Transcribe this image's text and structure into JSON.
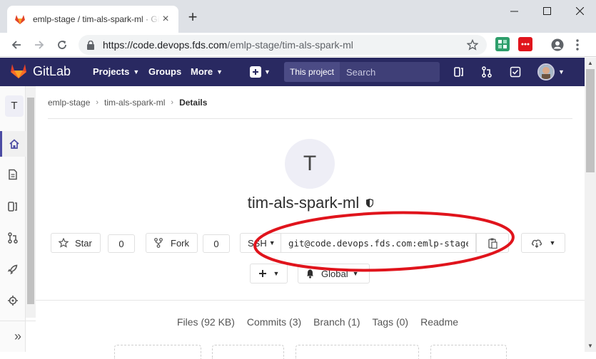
{
  "browser": {
    "tab_title": "emlp-stage / tim-als-spark-ml · GitLab",
    "tab_close": "×",
    "new_tab": "+",
    "url_host": "https://code.devops.fds.com",
    "url_path": "/emlp-stage/tim-als-spark-ml"
  },
  "gitlab_nav": {
    "brand": "GitLab",
    "projects": "Projects",
    "groups": "Groups",
    "more": "More",
    "scope": "This project",
    "search_placeholder": "Search"
  },
  "sidebar": {
    "project_initial": "T",
    "collapse_glyph": "»"
  },
  "breadcrumb": {
    "group": "emlp-stage",
    "project": "tim-als-spark-ml",
    "current": "Details"
  },
  "project": {
    "initial": "T",
    "name": "tim-als-spark-ml"
  },
  "actions": {
    "star_label": "Star",
    "star_count": "0",
    "fork_label": "Fork",
    "fork_count": "0",
    "clone_protocol": "SSH",
    "clone_url": "git@code.devops.fds.com:emlp-stage/tim-als-spark-ml.git",
    "notification_label": "Global"
  },
  "stats": {
    "files": "Files (92 KB)",
    "commits": "Commits (3)",
    "branch": "Branch (1)",
    "tags": "Tags (0)",
    "readme": "Readme"
  },
  "colors": {
    "gitlab_header": "#292961",
    "annotation_oval": "#e0141c"
  }
}
